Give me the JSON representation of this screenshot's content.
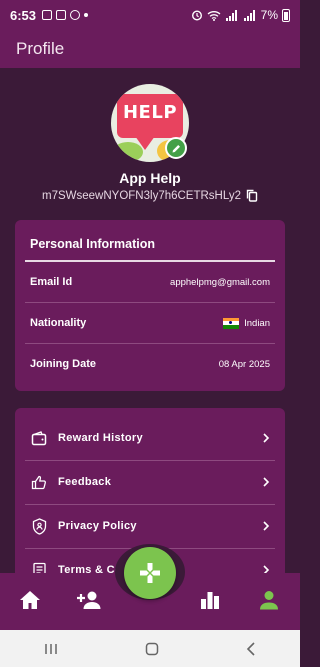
{
  "status_bar": {
    "time": "6:53",
    "battery": "7%"
  },
  "app_bar": {
    "title": "Profile"
  },
  "profile": {
    "avatar_text": "HELP",
    "name": "App Help",
    "uid": "m7SWseewNYOFN3ly7h6CETRsHLy2"
  },
  "personal_info": {
    "title": "Personal Information",
    "rows": [
      {
        "label": "Email Id",
        "value": "apphelpmg@gmail.com"
      },
      {
        "label": "Nationality",
        "value": "Indian"
      },
      {
        "label": "Joining Date",
        "value": "08 Apr 2025"
      }
    ]
  },
  "menu": {
    "items": [
      {
        "label": "Reward History",
        "icon": "wallet-icon"
      },
      {
        "label": "Feedback",
        "icon": "thumbs-up-icon"
      },
      {
        "label": "Privacy Policy",
        "icon": "shield-person-icon"
      },
      {
        "label": "Terms & Con",
        "icon": "document-icon"
      }
    ]
  },
  "bottom_nav": {
    "items": [
      "home-icon",
      "add-person-icon",
      "bar-chart-icon",
      "profile-icon"
    ],
    "fab_icon": "gamepad-icon"
  },
  "colors": {
    "background": "#3b1a38",
    "surface": "#6a1c5c",
    "accent_green": "#7cc44e"
  }
}
